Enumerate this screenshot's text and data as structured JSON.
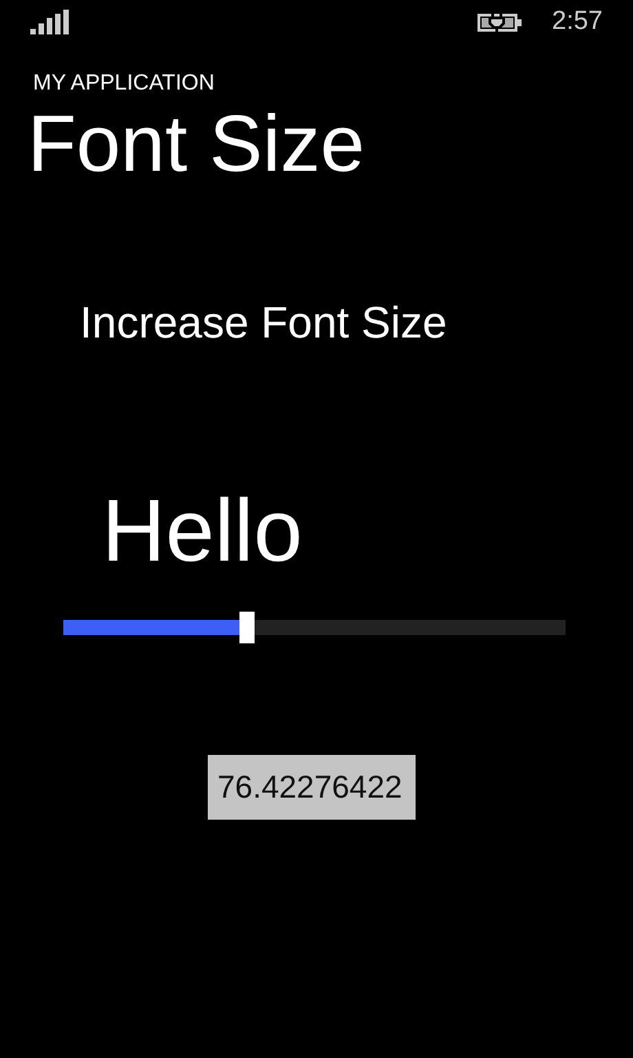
{
  "status_bar": {
    "time": "2:57"
  },
  "app_title": "MY APPLICATION",
  "page_title": "Font Size",
  "instruction": "Increase Font Size",
  "preview_text": "Hello",
  "slider": {
    "level": 0.356
  },
  "value_box": {
    "value": "76.42276422"
  }
}
